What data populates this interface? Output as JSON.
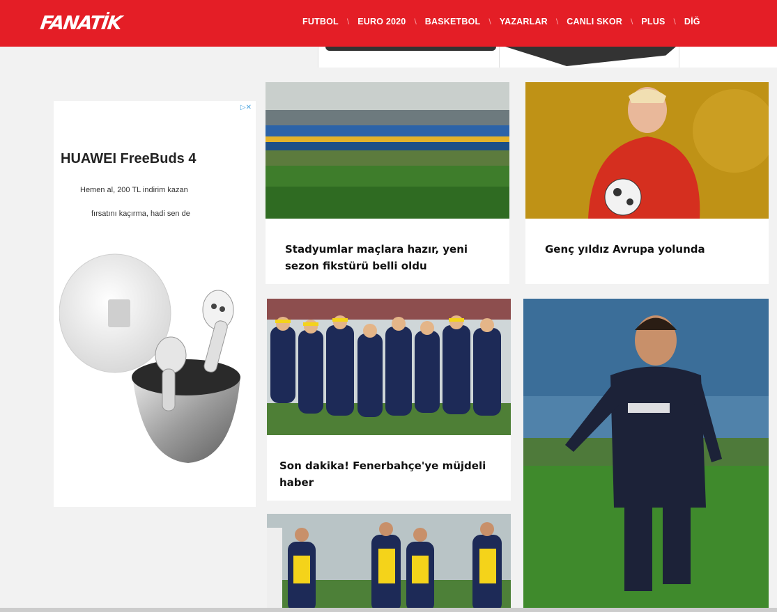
{
  "header": {
    "logo": "FANATİK",
    "nav": [
      "FUTBOL",
      "EURO 2020",
      "BASKETBOL",
      "YAZARLAR",
      "CANLI SKOR",
      "PLUS",
      "DİĞ"
    ]
  },
  "ad": {
    "choice_label": "▷✕",
    "title": "HUAWEI FreeBuds 4",
    "line1": "Hemen al, 200 TL indirim kazan",
    "line2": "fırsatını kaçırma, hadi sen de"
  },
  "cards": [
    {
      "title": "Stadyumlar maçlara hazır, yeni sezon fikstürü belli oldu"
    },
    {
      "title": "Genç yıldız Avrupa yolunda"
    },
    {
      "title": "Son dakika! Fenerbahçe'ye müjdeli haber"
    },
    {
      "title": ""
    },
    {
      "title": ""
    }
  ],
  "colors": {
    "brand_red": "#e41e26",
    "page_bg": "#f2f2f2"
  }
}
